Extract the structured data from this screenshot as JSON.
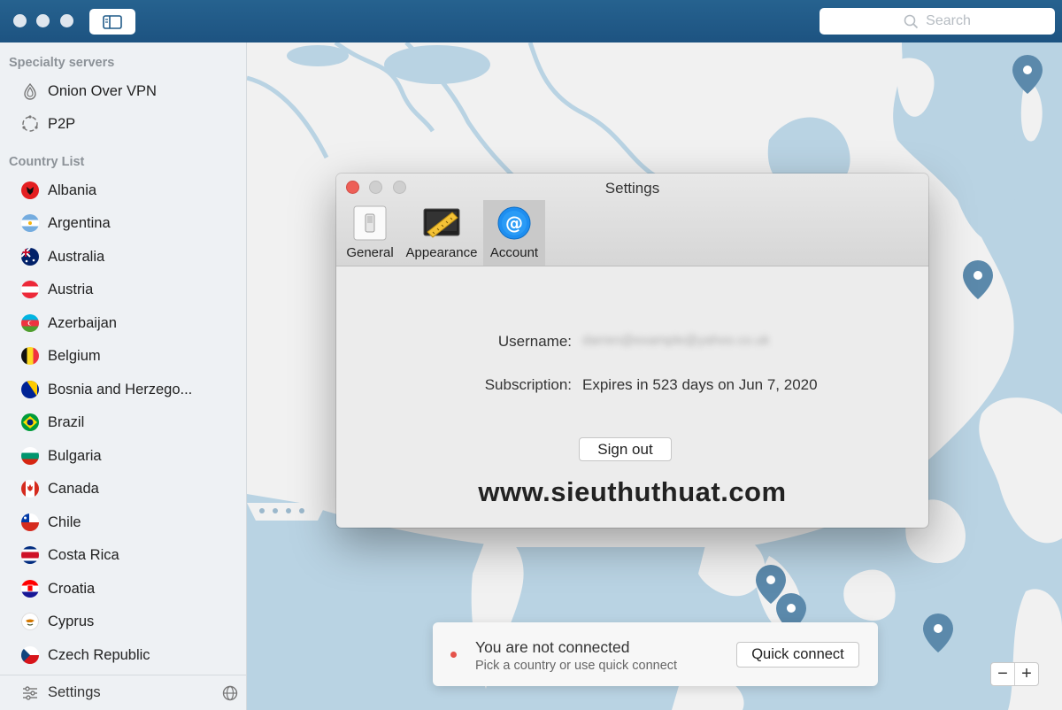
{
  "window": {
    "search_placeholder": "Search"
  },
  "sidebar": {
    "specialty_title": "Specialty servers",
    "specialty_items": [
      {
        "label": "Onion Over VPN",
        "icon": "onion-icon"
      },
      {
        "label": "P2P",
        "icon": "p2p-icon"
      }
    ],
    "country_title": "Country List",
    "countries": [
      {
        "label": "Albania"
      },
      {
        "label": "Argentina"
      },
      {
        "label": "Australia"
      },
      {
        "label": "Austria"
      },
      {
        "label": "Azerbaijan"
      },
      {
        "label": "Belgium"
      },
      {
        "label": "Bosnia and Herzego..."
      },
      {
        "label": "Brazil"
      },
      {
        "label": "Bulgaria"
      },
      {
        "label": "Canada"
      },
      {
        "label": "Chile"
      },
      {
        "label": "Costa Rica"
      },
      {
        "label": "Croatia"
      },
      {
        "label": "Cyprus"
      },
      {
        "label": "Czech Republic"
      }
    ],
    "footer_label": "Settings"
  },
  "settings_dialog": {
    "title": "Settings",
    "tabs": [
      {
        "label": "General",
        "icon": "switch-icon",
        "active": false
      },
      {
        "label": "Appearance",
        "icon": "display-ruler-icon",
        "active": false
      },
      {
        "label": "Account",
        "icon": "at-sign-icon",
        "active": true
      }
    ],
    "username_label": "Username:",
    "username_value": "darren@example@yahoo.co.uk",
    "subscription_label": "Subscription:",
    "subscription_value": "Expires in 523 days on Jun 7, 2020",
    "signout_label": "Sign out",
    "watermark": "www.sieuthuthuat.com"
  },
  "connection": {
    "status_title": "You are not connected",
    "status_subtitle": "Pick a country or use quick connect",
    "quick_connect_label": "Quick connect",
    "status_color": "#e5534b"
  },
  "map_controls": {
    "zoom_out": "−",
    "zoom_in": "+"
  },
  "colors": {
    "titlebar": "#1f5a88",
    "map_sea": "#b9d3e3",
    "map_land": "#f1f1f1",
    "pin": "#5b89ab"
  }
}
